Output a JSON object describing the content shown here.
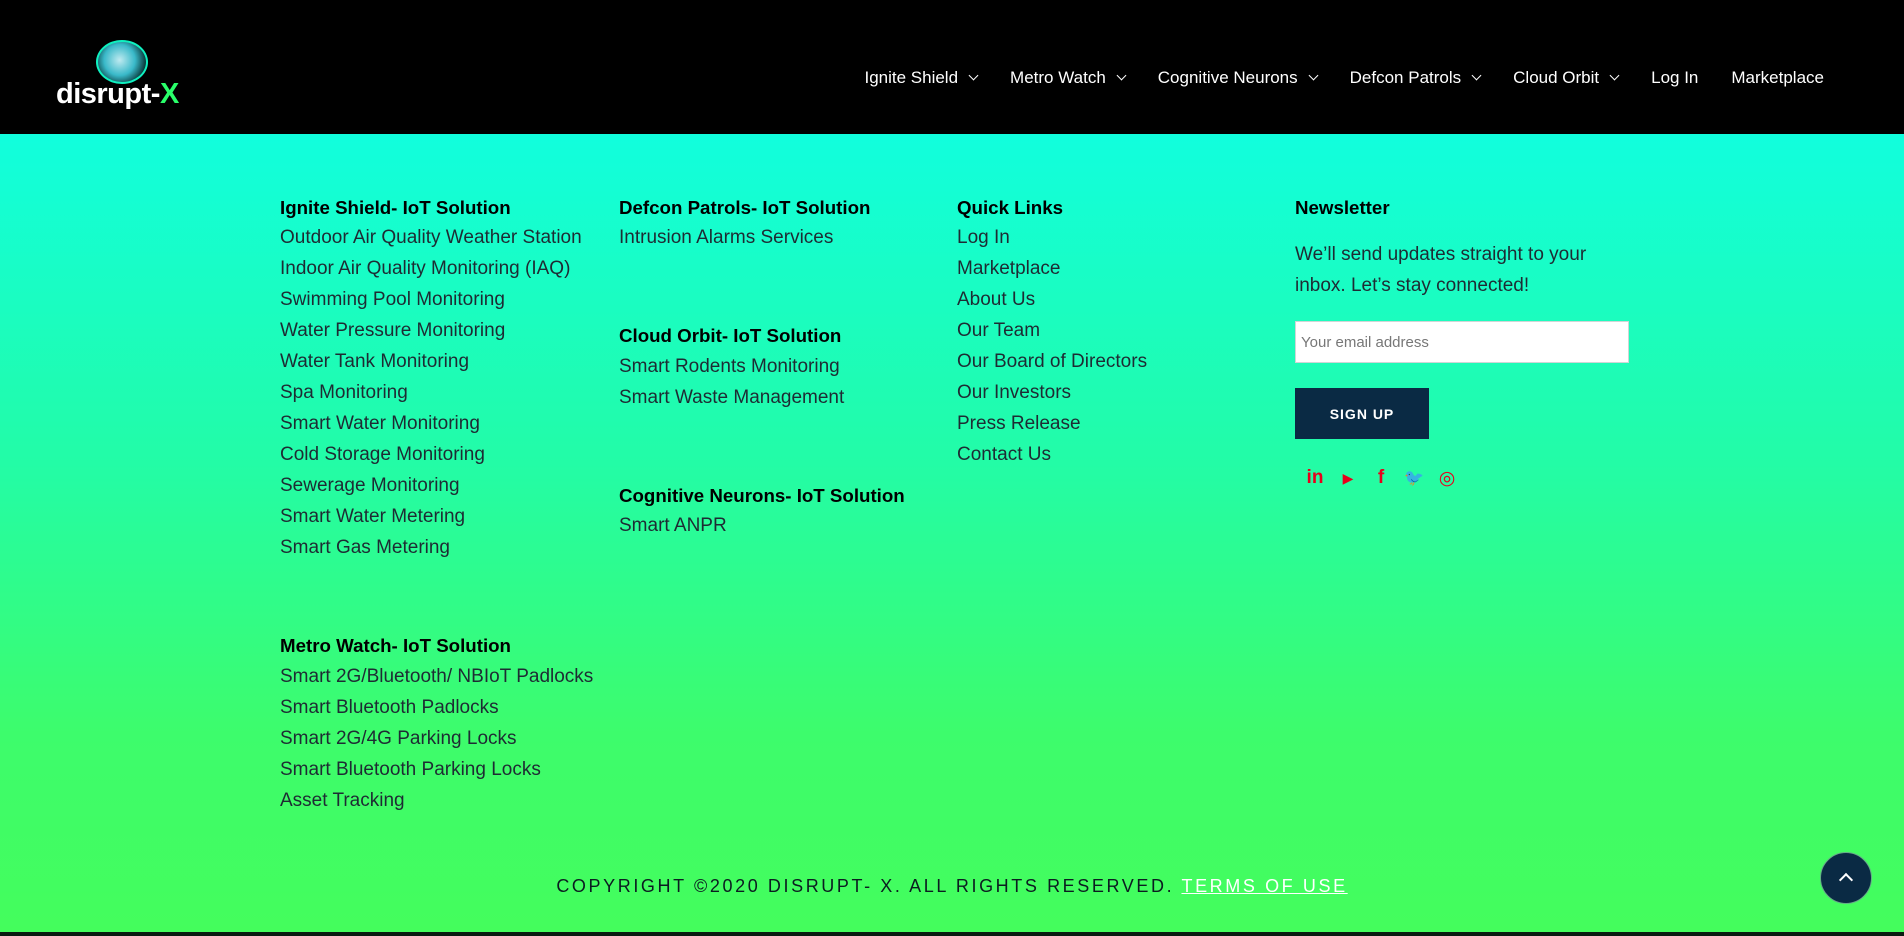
{
  "header": {
    "logo_text": "disrupt-",
    "logo_x": "X",
    "nav": [
      {
        "label": "Ignite Shield",
        "dropdown": true
      },
      {
        "label": "Metro Watch",
        "dropdown": true
      },
      {
        "label": "Cognitive Neurons",
        "dropdown": true
      },
      {
        "label": "Defcon Patrols",
        "dropdown": true
      },
      {
        "label": "Cloud Orbit",
        "dropdown": true
      },
      {
        "label": "Log In",
        "dropdown": false
      },
      {
        "label": "Marketplace",
        "dropdown": false
      }
    ]
  },
  "footer": {
    "ignite": {
      "title": "Ignite Shield- IoT Solution",
      "links": [
        "Outdoor Air Quality Weather Station",
        "Indoor Air Quality Monitoring (IAQ)",
        "Swimming Pool Monitoring",
        "Water Pressure Monitoring",
        "Water Tank Monitoring",
        "Spa Monitoring",
        "Smart Water Monitoring",
        "Cold Storage Monitoring",
        "Sewerage Monitoring",
        "Smart Water Metering",
        "Smart Gas Metering"
      ]
    },
    "metro": {
      "title": "Metro Watch- IoT Solution",
      "links": [
        "Smart 2G/Bluetooth/ NBIoT Padlocks",
        "Smart Bluetooth Padlocks",
        "Smart 2G/4G Parking Locks",
        "Smart Bluetooth Parking Locks",
        "Asset Tracking"
      ]
    },
    "defcon": {
      "title": "Defcon Patrols- IoT Solution",
      "links": [
        "Intrusion Alarms Services"
      ]
    },
    "cloud": {
      "title": "Cloud Orbit- IoT Solution",
      "links": [
        "Smart Rodents Monitoring",
        "Smart Waste Management"
      ]
    },
    "cognitive": {
      "title": "Cognitive Neurons- IoT Solution",
      "links": [
        "Smart ANPR"
      ]
    },
    "quick": {
      "title": "Quick Links",
      "links": [
        "Log In",
        "Marketplace",
        "About Us",
        "Our Team",
        "Our Board of Directors",
        "Our Investors",
        "Press Release",
        "Contact Us"
      ]
    },
    "newsletter": {
      "title": "Newsletter",
      "text": "We’ll send updates straight to your inbox. Let’s stay connected!",
      "placeholder": "Your email address",
      "button": "SIGN UP"
    },
    "socials": [
      {
        "icon": "linkedin-icon",
        "glyph": "in"
      },
      {
        "icon": "youtube-icon",
        "glyph": "▶"
      },
      {
        "icon": "facebook-icon",
        "glyph": "f"
      },
      {
        "icon": "twitter-icon",
        "glyph": "🐦"
      },
      {
        "icon": "instagram-icon",
        "glyph": "◎"
      }
    ],
    "copyright": "COPYRIGHT ©2020 DISRUPT- X. ALL RIGHTS RESERVED.",
    "terms": "TERMS OF USE"
  },
  "colors": {
    "header_bg": "#000000",
    "footer_top": "#11fedd",
    "footer_bottom": "#44fd5c",
    "button_bg": "#0a2a44",
    "social_red": "#e8001c"
  }
}
